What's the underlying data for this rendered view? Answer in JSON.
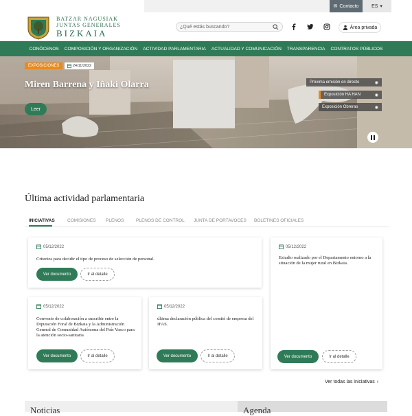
{
  "topbar": {
    "contact": "Contacto",
    "language": "ES"
  },
  "brand": {
    "line1": "BATZAR NAGUSIAK",
    "line2": "JUNTAS GENERALES",
    "line3": "BIZKAIA"
  },
  "search": {
    "placeholder": "¿Qué estás buscando?"
  },
  "header": {
    "private_area": "Área privada"
  },
  "nav": [
    "CONÓCENOS",
    "COMPOSICIÓN Y ORGANIZACIÓN",
    "ACTIVIDAD PARLAMENTARIA",
    "ACTUALIDAD Y COMUNICACIÓN",
    "TRANSPARENCIA",
    "CONTRATOS PÚBLICOS"
  ],
  "hero": {
    "tag": "EXPOSICIONES",
    "date": "24/11/2022",
    "title": "Miren Barrena y Iñaki Olarra",
    "button": "Leer",
    "links": [
      "Próxima emisión en directo",
      "Exposición HA HAN",
      "Exposición Obreras"
    ]
  },
  "section": {
    "title": "Última actividad parlamentaria"
  },
  "tabs": [
    "INICIATIVAS",
    "COMISIONES",
    "PLENOS",
    "PLENOS DE CONTROL",
    "JUNTA DE PORTAVOCES",
    "BOLETINES OFICIALES"
  ],
  "cards": [
    {
      "date": "05/12/2022",
      "text": "Criterios para decidir el tipo de proceso de selección de personal.",
      "doc": "Ver documento",
      "detail": "Ir al detalle"
    },
    {
      "date": "05/12/2022",
      "text": "Estudio realizado por el Departamento entorno a la situación de la mujer rural en Bizkaia.",
      "doc": "Ver documento",
      "detail": "Ir al detalle"
    },
    {
      "date": "05/12/2022",
      "text": "Convenio de colaboración a suscribir entre la Diputación Foral de Bizkaia y la Administración General de Comunidad Autónoma del País Vasco para la atención socio-sanitaria",
      "doc": "Ver documento",
      "detail": "Ir al detalle"
    },
    {
      "date": "05/12/2022",
      "text": "última declaración pública del comité de empresa del IFAS.",
      "doc": "Ver documento",
      "detail": "Ir al detalle"
    }
  ],
  "see_all": "Ver todas las iniciativas",
  "bottom": {
    "left": "Noticias",
    "right": "Agenda"
  },
  "colors": {
    "green": "#2f7b58",
    "orange": "#e98a1f"
  }
}
